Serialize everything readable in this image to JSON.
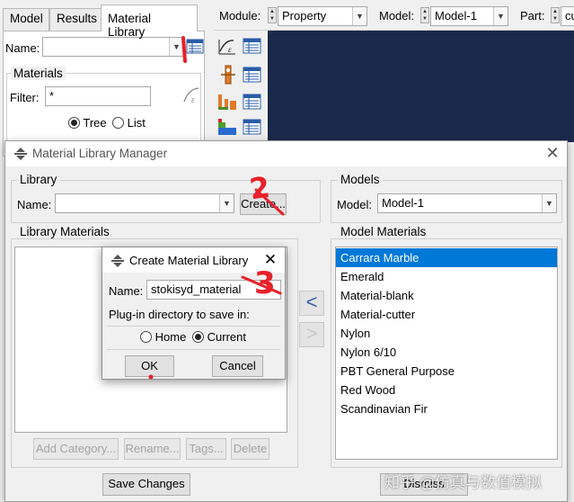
{
  "tabs": [
    {
      "label": "Model"
    },
    {
      "label": "Results"
    },
    {
      "label": "Material Library"
    }
  ],
  "toolbar": {
    "module_label": "Module:",
    "module_value": "Property",
    "model_label": "Model:",
    "model_value": "Model-1",
    "part_label": "Part:",
    "part_value": "cut"
  },
  "left_panel": {
    "name_label": "Name:",
    "name_value": "",
    "materials_group": "Materials",
    "filter_label": "Filter:",
    "filter_value": "*",
    "tree_label": "Tree",
    "list_label": "List",
    "view_mode": "Tree"
  },
  "manager": {
    "title": "Material Library Manager",
    "library_group": "Library",
    "name_label": "Name:",
    "name_value": "",
    "create_button": "Create...",
    "library_materials_group": "Library Materials",
    "add_category_button": "Add Category...",
    "rename_button": "Rename...",
    "tags_button": "Tags...",
    "delete_button": "Delete",
    "save_changes_button": "Save Changes",
    "models_group": "Models",
    "model_label": "Model:",
    "model_value": "Model-1",
    "model_materials_group": "Model Materials",
    "model_materials": [
      "Carrara Marble",
      "Emerald",
      "Material-blank",
      "Material-cutter",
      "Nylon",
      "Nylon 6/10",
      "PBT General Purpose",
      "Red Wood",
      "Scandinavian Fir"
    ],
    "selected_material": "Carrara Marble",
    "dismiss_button": "Dismiss"
  },
  "create_dialog": {
    "title": "Create Material Library",
    "name_label": "Name:",
    "name_value": "stokisyd_material",
    "plugin_label": "Plug-in directory to save in:",
    "home_label": "Home",
    "current_label": "Current",
    "selected_dir": "Current",
    "ok_button": "OK",
    "cancel_button": "Cancel"
  },
  "annotations": {
    "step2": "2",
    "step3": "3",
    "color": "#e8202a"
  },
  "watermark": "知乎 @仿真与数值模拟",
  "icons": [
    "list-table-icon",
    "material-edit-icon",
    "section-icon",
    "assign-section-icon",
    "profile-icon",
    "orientation-icon",
    "close-icon",
    "abaqus-logo-icon",
    "arrow-left-icon",
    "arrow-right-icon"
  ]
}
